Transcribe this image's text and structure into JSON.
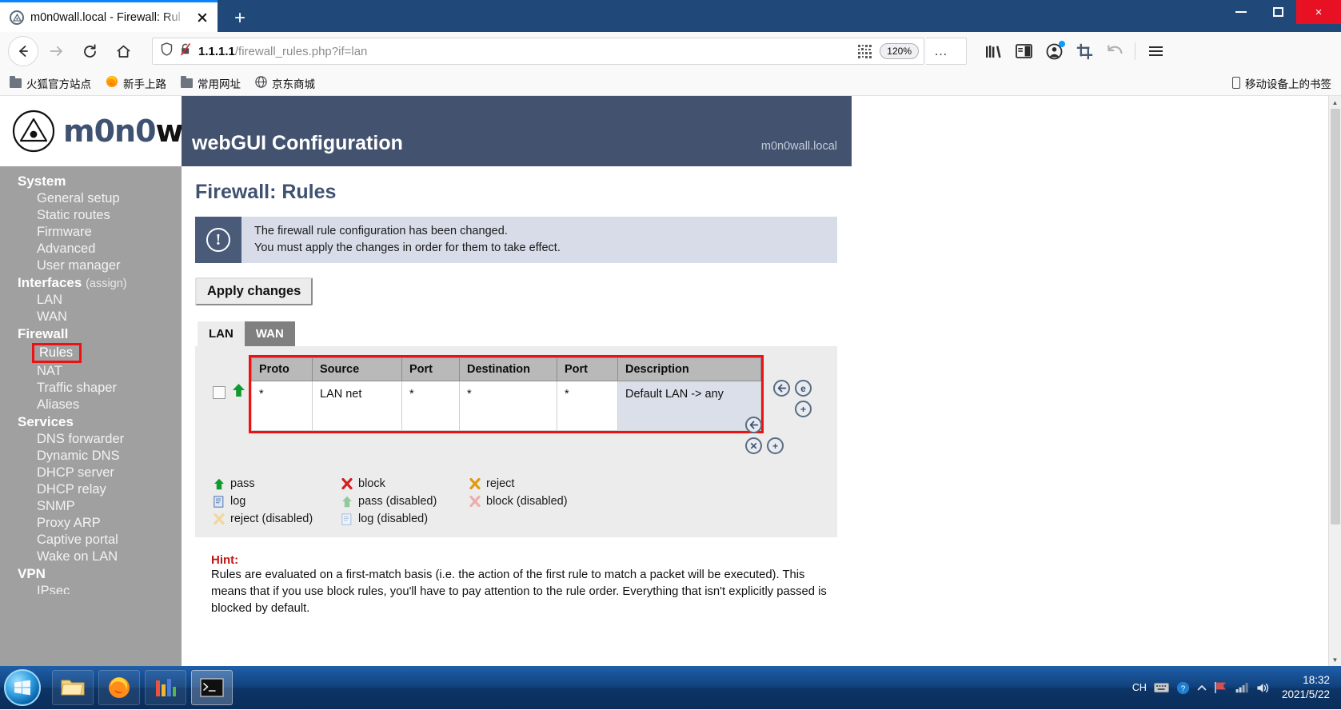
{
  "browser": {
    "tab": {
      "title": "m0n0wall.local - Firewall: Rul",
      "favicon": "m0n0wall-icon",
      "close": "×"
    },
    "newtab_label": "+",
    "window_controls": {
      "minimize": "minimize-icon",
      "maximize": "maximize-icon",
      "close": "×"
    },
    "nav": {
      "back": "back-arrow-icon",
      "forward": "forward-arrow-icon",
      "reload": "reload-icon",
      "home": "home-icon"
    },
    "address": {
      "shield_icon": "tracking-protection-shield-icon",
      "security_icon": "broken-lock-icon",
      "url_host": "1.1.1.1",
      "url_path": "/firewall_rules.php?if=lan",
      "qr_icon": "qr-code-icon",
      "zoom_level": "120%",
      "page_actions": "…",
      "bookmark_star": "☆"
    },
    "toolbar_right": {
      "library": "library-icon",
      "sidebar": "sidebar-icon",
      "account": "account-icon",
      "screenshot": "screenshot-crop-icon",
      "undo": "undo-arrow-icon",
      "menu": "hamburger-menu-icon"
    },
    "bookmarks": [
      {
        "label": "火狐官方站点",
        "icon": "folder-icon"
      },
      {
        "label": "新手上路",
        "icon": "firefox-icon"
      },
      {
        "label": "常用网址",
        "icon": "folder-icon"
      },
      {
        "label": "京东商城",
        "icon": "globe-icon"
      }
    ],
    "bookmarks_right": {
      "label": "移动设备上的书签",
      "icon": "mobile-device-icon"
    }
  },
  "app": {
    "logo": {
      "word1": "m0n0",
      "word2": "wall",
      "registered": "®",
      "mark": "m0n0wall-triangle-logo"
    },
    "header": {
      "title": "webGUI Configuration",
      "hostname": "m0n0wall.local"
    },
    "page_title": "Firewall: Rules"
  },
  "sidebar": {
    "sections": [
      {
        "heading": "System",
        "suffix": "",
        "items": [
          "General setup",
          "Static routes",
          "Firmware",
          "Advanced",
          "User manager"
        ]
      },
      {
        "heading": "Interfaces",
        "suffix": "(assign)",
        "items": [
          "LAN",
          "WAN"
        ]
      },
      {
        "heading": "Firewall",
        "suffix": "",
        "items": [
          "Rules",
          "NAT",
          "Traffic shaper",
          "Aliases"
        ]
      },
      {
        "heading": "Services",
        "suffix": "",
        "items": [
          "DNS forwarder",
          "Dynamic DNS",
          "DHCP server",
          "DHCP relay",
          "SNMP",
          "Proxy ARP",
          "Captive portal",
          "Wake on LAN"
        ]
      },
      {
        "heading": "VPN",
        "suffix": "",
        "items": [
          "IPsec"
        ]
      }
    ],
    "highlighted_item": "Rules",
    "highlight_color": "#ee1111"
  },
  "notice": {
    "icon": "exclamation-icon",
    "line1": "The firewall rule configuration has been changed.",
    "line2": "You must apply the changes in order for them to take effect."
  },
  "apply_button": {
    "label": "Apply changes"
  },
  "tabs": [
    {
      "label": "LAN",
      "selected": true
    },
    {
      "label": "WAN",
      "selected": false
    }
  ],
  "rules_table": {
    "highlight_color": "#ee1111",
    "columns": [
      "Proto",
      "Source",
      "Port",
      "Destination",
      "Port",
      "Description"
    ],
    "rows": [
      {
        "checkbox": false,
        "action_icon": "green-up-arrow-pass-icon",
        "proto": "*",
        "source": "LAN net",
        "src_port": "*",
        "destination": "*",
        "dst_port": "*",
        "description": "Default LAN -> any"
      }
    ],
    "row_action_icons": [
      "move-rule-icon",
      "edit-rule-icon",
      "add-rule-icon"
    ],
    "table_action_icons": [
      "move-selected-icon",
      "delete-selected-icon",
      "add-new-rule-icon"
    ]
  },
  "legend": [
    {
      "icon": "green-up-arrow-icon",
      "label": "pass"
    },
    {
      "icon": "red-x-icon",
      "label": "block"
    },
    {
      "icon": "orange-x-icon",
      "label": "reject"
    },
    {
      "icon": "log-page-icon",
      "label": "log"
    },
    {
      "icon": "green-up-arrow-disabled-icon",
      "label": "pass (disabled)"
    },
    {
      "icon": "red-x-disabled-icon",
      "label": "block (disabled)"
    },
    {
      "icon": "orange-x-disabled-icon",
      "label": "reject (disabled)"
    },
    {
      "icon": "log-page-disabled-icon",
      "label": "log (disabled)"
    }
  ],
  "hint": {
    "label": "Hint:",
    "text": "Rules are evaluated on a first-match basis (i.e. the action of the first rule to match a packet will be executed). This means that if you use block rules, you'll have to pay attention to the rule order. Everything that isn't explicitly passed is blocked by default."
  },
  "taskbar": {
    "start": "windows-start-orb",
    "apps": [
      {
        "icon": "file-explorer-icon",
        "active": false
      },
      {
        "icon": "firefox-icon",
        "active": false
      },
      {
        "icon": "app-colored-icon",
        "active": false
      },
      {
        "icon": "terminal-icon",
        "active": true
      }
    ],
    "tray": {
      "ime": "CH",
      "icons": [
        "keyboard-icon",
        "input-method-icon",
        "help-icon",
        "chevron-up-icon",
        "flag-icon",
        "network-icon",
        "volume-icon"
      ],
      "time": "18:32",
      "date": "2021/5/22"
    }
  }
}
